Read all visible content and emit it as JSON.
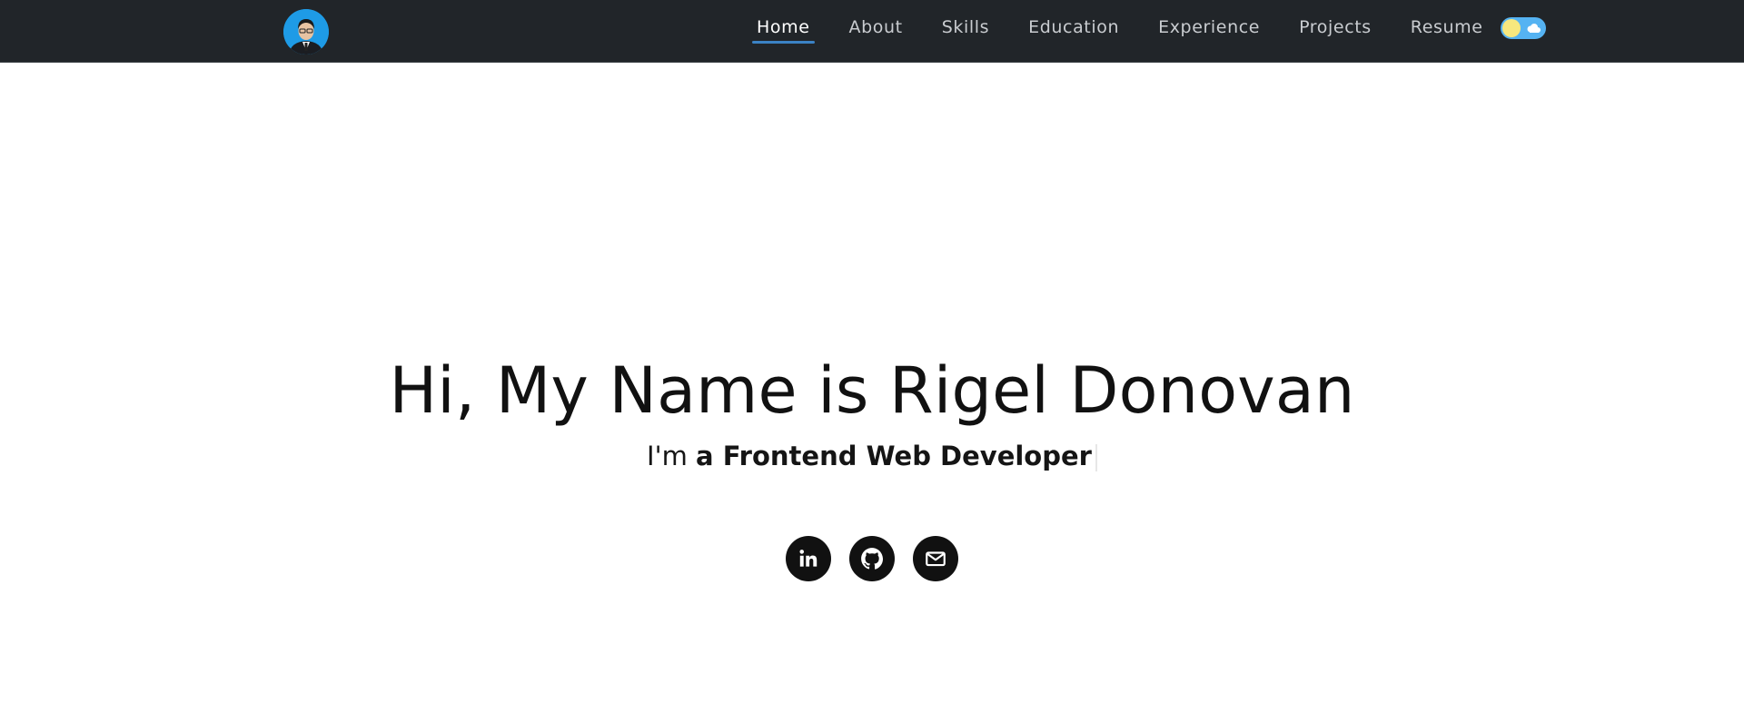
{
  "nav": {
    "links": [
      "Home",
      "About",
      "Skills",
      "Education",
      "Experience",
      "Projects",
      "Resume"
    ],
    "active": "Home",
    "theme_toggle": "light"
  },
  "hero": {
    "greeting": "Hi, My Name is Rigel Donovan",
    "prefix": "I'm ",
    "role": "a Frontend Web Developer"
  },
  "socials": {
    "icons": [
      "linkedin-icon",
      "github-icon",
      "email-icon"
    ]
  },
  "colors": {
    "navbar_bg": "#212529",
    "active_underline": "#3b82c4",
    "avatar_bg": "#1e9be6",
    "toggle_bg": "#55b3f2",
    "toggle_knob": "#f7e87e",
    "social_bg": "#111111"
  }
}
